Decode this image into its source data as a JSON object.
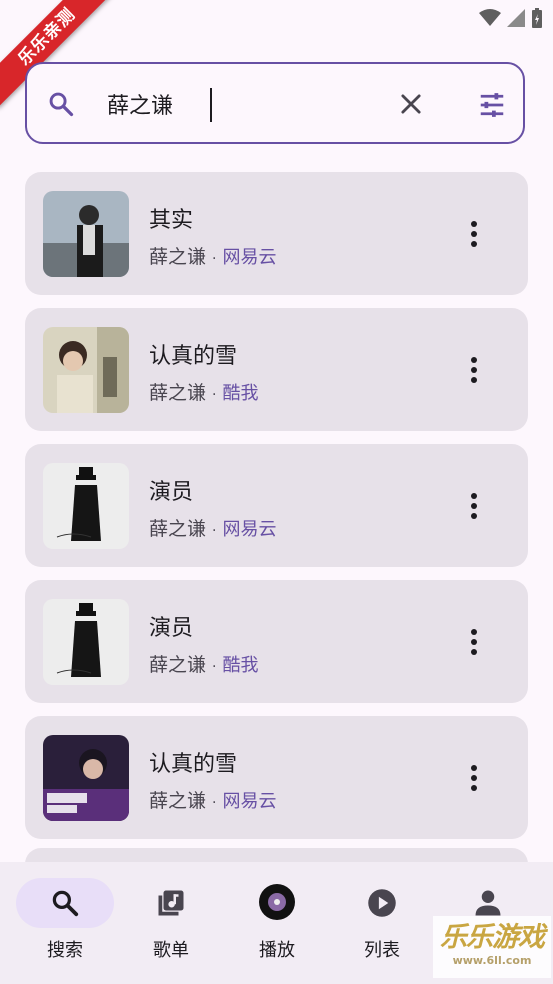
{
  "watermark": {
    "ribbon_text": "乐乐亲测",
    "corner_brand": "乐乐游戏",
    "corner_url": "www.6ll.com"
  },
  "search": {
    "value": "薛之谦",
    "placeholder": ""
  },
  "songs": [
    {
      "title": "其实",
      "artist": "薛之谦",
      "source": "网易云"
    },
    {
      "title": "认真的雪",
      "artist": "薛之谦",
      "source": "酷我"
    },
    {
      "title": "演员",
      "artist": "薛之谦",
      "source": "网易云"
    },
    {
      "title": "演员",
      "artist": "薛之谦",
      "source": "酷我"
    },
    {
      "title": "认真的雪",
      "artist": "薛之谦",
      "source": "网易云"
    }
  ],
  "nav": [
    {
      "label": "搜索",
      "icon": "search-icon",
      "active": true
    },
    {
      "label": "歌单",
      "icon": "playlist-icon",
      "active": false
    },
    {
      "label": "播放",
      "icon": "now-playing-cover",
      "active": false
    },
    {
      "label": "列表",
      "icon": "play-circle-icon",
      "active": false
    },
    {
      "label": "",
      "icon": "person-icon",
      "active": false
    }
  ],
  "colors": {
    "accent": "#6750a4",
    "card": "#e7e1e9",
    "background": "#fdf7fd",
    "nav_active": "#e8def8"
  }
}
